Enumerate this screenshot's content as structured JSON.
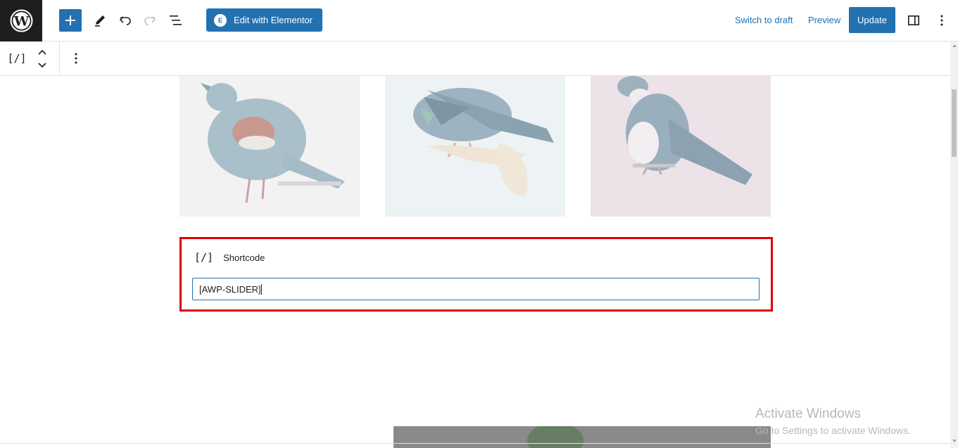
{
  "topbar": {
    "elementor_button_label": "Edit with Elementor",
    "switch_to_draft_label": "Switch to draft",
    "preview_label": "Preview",
    "update_label": "Update"
  },
  "block_toolbar": {
    "block_type_icon": "[/]"
  },
  "shortcode_block": {
    "icon": "[/]",
    "label": "Shortcode",
    "value": "[AWP-SLIDER]"
  },
  "watermark": {
    "title": "Activate Windows",
    "subtitle": "Go to Settings to activate Windows."
  },
  "colors": {
    "accent": "#2271b1",
    "highlight_border": "#dd0000"
  },
  "icons": [
    "wordpress-logo",
    "plus-icon",
    "pencil-icon",
    "undo-icon",
    "redo-icon",
    "list-view-icon",
    "elementor-icon",
    "settings-panel-icon",
    "more-vertical-icon",
    "shortcode-icon",
    "chevron-up-icon",
    "chevron-down-icon"
  ]
}
